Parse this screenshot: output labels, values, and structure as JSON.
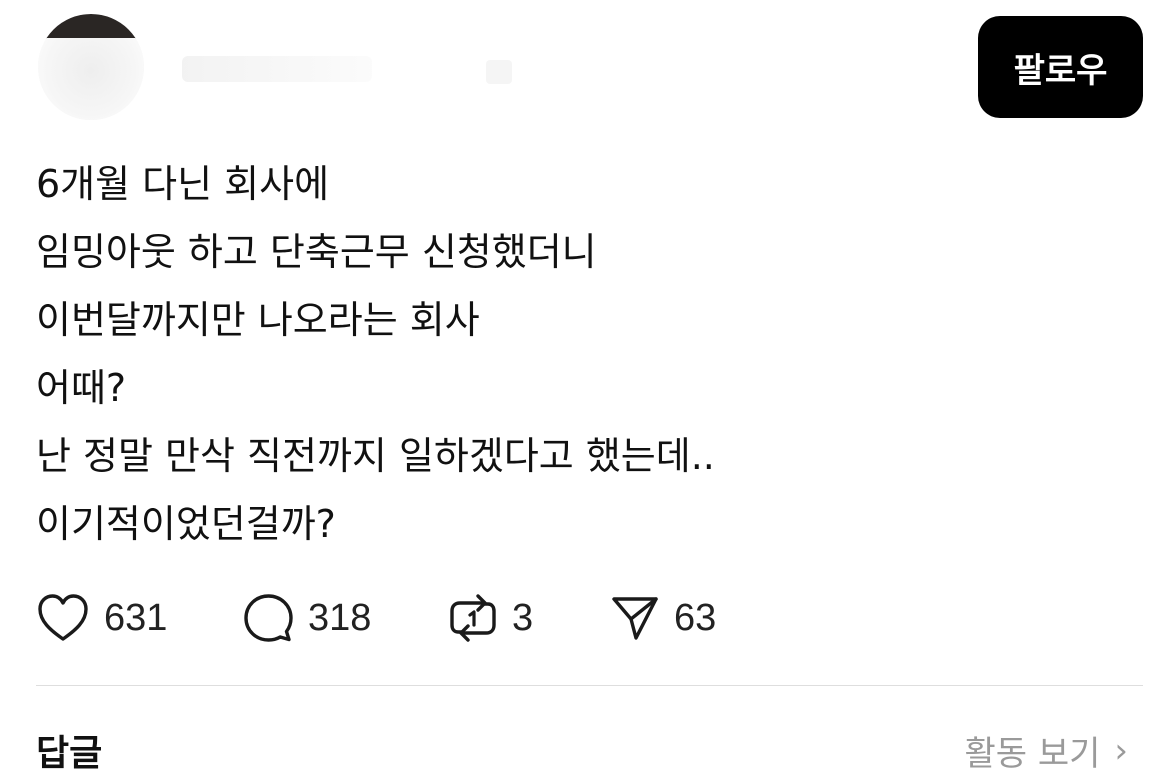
{
  "header": {
    "follow_label": "팔로우"
  },
  "post": {
    "lines": [
      "6개월 다닌 회사에",
      "임밍아웃 하고 단축근무 신청했더니",
      "이번달까지만 나오라는 회사",
      "어때?",
      "난 정말 만삭 직전까지 일하겠다고 했는데..",
      "이기적이었던걸까?"
    ]
  },
  "actions": {
    "likes": "631",
    "replies": "318",
    "reposts": "3",
    "shares": "63"
  },
  "replies_section": {
    "title": "답글",
    "view_activity_label": "활동 보기",
    "chevron": "›"
  },
  "icons": {
    "like": "heart-icon",
    "reply": "speech-bubble-icon",
    "repost": "repost-icon",
    "share": "send-icon",
    "chevron": "chevron-right-icon"
  },
  "colors": {
    "follow_button_bg": "#000000",
    "follow_button_text": "#ffffff",
    "muted_text": "#9a9a9a"
  }
}
